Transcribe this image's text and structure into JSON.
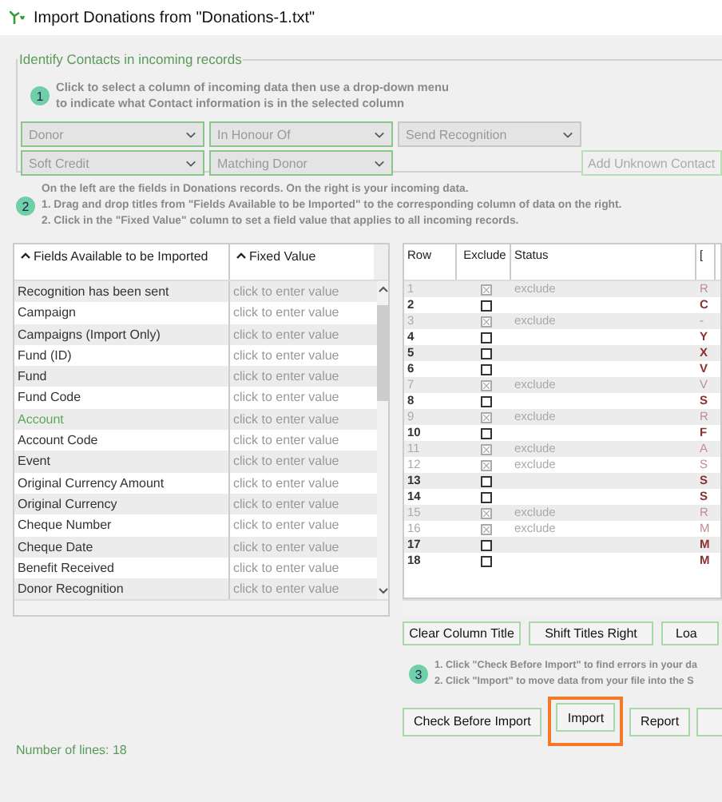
{
  "window": {
    "title": "Import Donations from \"Donations-1.txt\""
  },
  "identify_contacts": {
    "legend": "Identify Contacts in incoming records",
    "step": "1",
    "instructions": [
      "Click to select a column of incoming data then use a drop-down menu",
      "to indicate what Contact information is in the selected column"
    ],
    "dropdowns": [
      {
        "value": "Donor",
        "disabled": false
      },
      {
        "value": "In Honour Of",
        "disabled": false
      },
      {
        "value": "Send Recognition",
        "disabled": true
      },
      {
        "value": "Soft Credit",
        "disabled": false
      },
      {
        "value": "Matching Donor",
        "disabled": false
      }
    ],
    "add_button": {
      "label": "Add Unknown Contact",
      "disabled": true
    }
  },
  "step_2": {
    "step": "2",
    "lines": [
      "On the left are the fields in Donations records. On the right is your incoming data.",
      "1. Drag and drop titles from \"Fields Available to be Imported\" to the corresponding column of data on the right.",
      "2. Click in the \"Fixed Value\" column to set a field value that applies to all incoming records."
    ]
  },
  "fields_table": {
    "columns": [
      "Fields Available to be Imported",
      "Fixed Value"
    ],
    "rows": [
      {
        "field": "Recognition has been sent",
        "highlighted": false,
        "placeholder": "click to enter value"
      },
      {
        "field": "Campaign",
        "highlighted": false,
        "placeholder": "click to enter value"
      },
      {
        "field": "Campaigns (Import Only)",
        "highlighted": false,
        "placeholder": "click to enter value"
      },
      {
        "field": "Fund (ID)",
        "highlighted": false,
        "placeholder": "click to enter value"
      },
      {
        "field": "Fund",
        "highlighted": false,
        "placeholder": "click to enter value"
      },
      {
        "field": "Fund Code",
        "highlighted": false,
        "placeholder": "click to enter value"
      },
      {
        "field": "Account",
        "highlighted": true,
        "placeholder": "click to enter value"
      },
      {
        "field": "Account Code",
        "highlighted": false,
        "placeholder": "click to enter value"
      },
      {
        "field": "Event",
        "highlighted": false,
        "placeholder": "click to enter value"
      },
      {
        "field": "Original Currency Amount",
        "highlighted": false,
        "placeholder": "click to enter value"
      },
      {
        "field": "Original Currency",
        "highlighted": false,
        "placeholder": "click to enter value"
      },
      {
        "field": "Cheque Number",
        "highlighted": false,
        "placeholder": "click to enter value"
      },
      {
        "field": "Cheque Date",
        "highlighted": false,
        "placeholder": "click to enter value"
      },
      {
        "field": "Benefit Received",
        "highlighted": false,
        "placeholder": "click to enter value"
      },
      {
        "field": "Donor Recognition",
        "highlighted": false,
        "placeholder": "click to enter value"
      }
    ]
  },
  "data_table": {
    "columns": [
      "Row",
      "Exclude",
      "Status",
      "["
    ],
    "rows": [
      {
        "row": "1",
        "excluded": true,
        "status": "exclude",
        "column_4": "R"
      },
      {
        "row": "2",
        "excluded": false,
        "column_4": "C"
      },
      {
        "row": "3",
        "excluded": true,
        "status": "exclude",
        "column_4": "-"
      },
      {
        "row": "4",
        "excluded": false,
        "column_4": "Y"
      },
      {
        "row": "5",
        "excluded": false,
        "column_4": "X"
      },
      {
        "row": "6",
        "excluded": false,
        "column_4": "V"
      },
      {
        "row": "7",
        "excluded": true,
        "status": "exclude",
        "column_4": "V"
      },
      {
        "row": "8",
        "excluded": false,
        "column_4": "S"
      },
      {
        "row": "9",
        "excluded": true,
        "status": "exclude",
        "column_4": "R"
      },
      {
        "row": "10",
        "excluded": false,
        "column_4": "F"
      },
      {
        "row": "11",
        "excluded": true,
        "status": "exclude",
        "column_4": "A"
      },
      {
        "row": "12",
        "excluded": true,
        "status": "exclude",
        "column_4": "S"
      },
      {
        "row": "13",
        "excluded": false,
        "column_4": "S"
      },
      {
        "row": "14",
        "excluded": false,
        "column_4": "S"
      },
      {
        "row": "15",
        "excluded": true,
        "status": "exclude",
        "column_4": "R"
      },
      {
        "row": "16",
        "excluded": true,
        "status": "exclude",
        "column_4": "M"
      },
      {
        "row": "17",
        "excluded": false,
        "column_4": "M"
      },
      {
        "row": "18",
        "excluded": false,
        "column_4": "M"
      }
    ]
  },
  "column_buttons": [
    {
      "kind": "button",
      "label": "Clear Column Title"
    },
    {
      "kind": "button",
      "label": "Shift Titles Right"
    },
    {
      "kind": "button",
      "label": "Loa"
    }
  ],
  "step_3": {
    "step": "3",
    "lines": [
      "1. Click \"Check Before Import\" to find errors in your da",
      "2. Click \"Import\" to move data from your file into the S"
    ]
  },
  "action_buttons": [
    {
      "kind": "button",
      "label": "Check Before Import",
      "highlighted": false
    },
    {
      "kind": "button",
      "label": "Import",
      "highlighted": true
    },
    {
      "kind": "button",
      "label": "Report",
      "highlighted": false
    },
    {
      "kind": "cut-off",
      "highlighted": false
    }
  ],
  "status_bar": {
    "text": "Number of lines: 18"
  }
}
